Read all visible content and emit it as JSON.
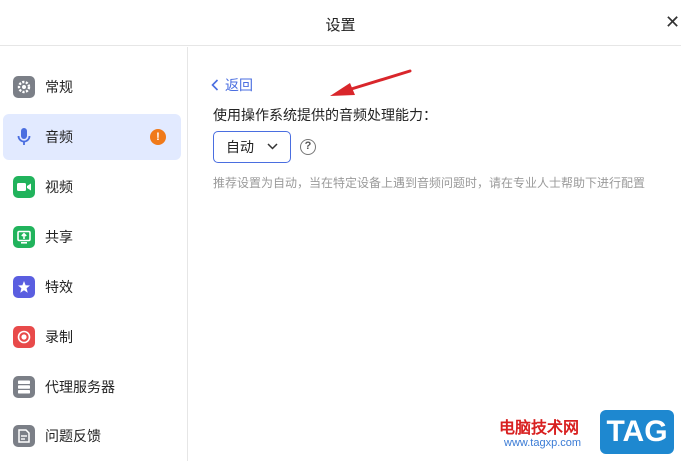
{
  "window": {
    "title": "设置",
    "close_glyph": "✕"
  },
  "sidebar": {
    "items": [
      {
        "label": "常规",
        "icon": "gear-icon",
        "color": "#7b7f87"
      },
      {
        "label": "音频",
        "icon": "microphone-icon",
        "color": "#4a6ee0",
        "active": true,
        "badge": "!"
      },
      {
        "label": "视频",
        "icon": "video-camera-icon",
        "color": "#21b35c"
      },
      {
        "label": "共享",
        "icon": "screen-share-icon",
        "color": "#21b35c"
      },
      {
        "label": "特效",
        "icon": "effects-icon",
        "color": "#5a5ee0"
      },
      {
        "label": "录制",
        "icon": "record-icon",
        "color": "#e84a4a"
      },
      {
        "label": "代理服务器",
        "icon": "server-icon",
        "color": "#7b7f87"
      },
      {
        "label": "问题反馈",
        "icon": "feedback-icon",
        "color": "#7b7f87"
      }
    ]
  },
  "content": {
    "back_label": "返回",
    "question": "使用操作系统提供的音频处理能力：",
    "select": {
      "value": "自动"
    },
    "help_glyph": "?",
    "hint": "推荐设置为自动，当在特定设备上遇到音频问题时，请在专业人士帮助下进行配置"
  },
  "watermark": {
    "text": "电脑技术网",
    "url": "www.tagxp.com",
    "logo": "TAG"
  },
  "colors": {
    "accent": "#4a6ee0",
    "active_bg": "#e2eaff",
    "badge": "#f07a1a",
    "annotation_arrow": "#d9262b"
  }
}
